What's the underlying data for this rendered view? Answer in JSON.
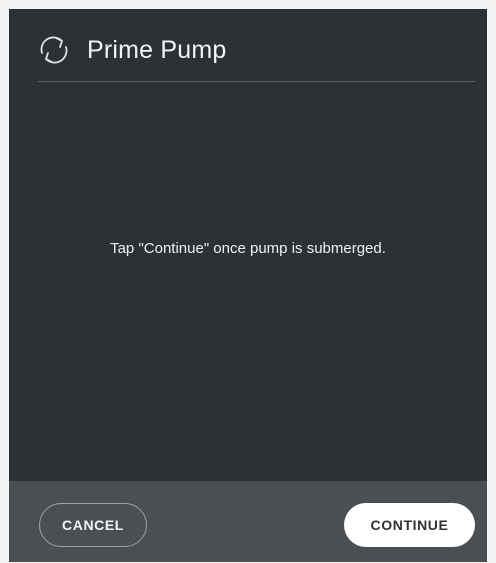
{
  "dialog": {
    "title": "Prime Pump",
    "title_icon": "refresh-cycle-icon",
    "message": "Tap \"Continue\" once pump is submerged."
  },
  "footer": {
    "cancel_label": "CANCEL",
    "continue_label": "CONTINUE"
  },
  "colors": {
    "background": "#2d3134",
    "footer": "#4a4f53",
    "text": "#f2f4f5",
    "primary_button": "#ffffff"
  }
}
